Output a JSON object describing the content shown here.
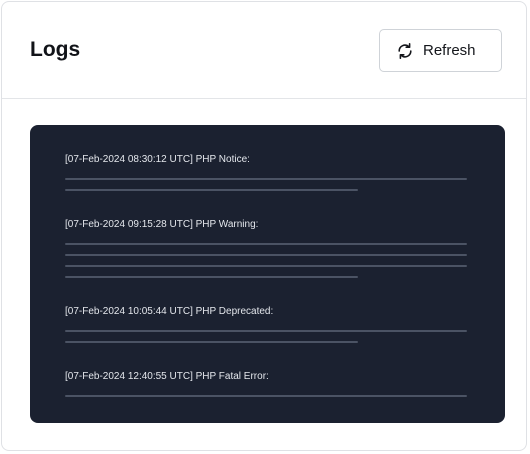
{
  "header": {
    "title": "Logs",
    "refresh_label": "Refresh",
    "refresh_icon": "refresh-icon"
  },
  "logs": {
    "entries": [
      {
        "text": "[07-Feb-2024 08:30:12 UTC] PHP Notice:"
      },
      {
        "text": "[07-Feb-2024 09:15:28 UTC] PHP Warning:"
      },
      {
        "text": "[07-Feb-2024 10:05:44 UTC] PHP Deprecated:"
      },
      {
        "text": "[07-Feb-2024 12:40:55 UTC] PHP Fatal Error:"
      }
    ]
  },
  "colors": {
    "console_bg": "#1b2130",
    "placeholder_line": "#4b5364"
  }
}
